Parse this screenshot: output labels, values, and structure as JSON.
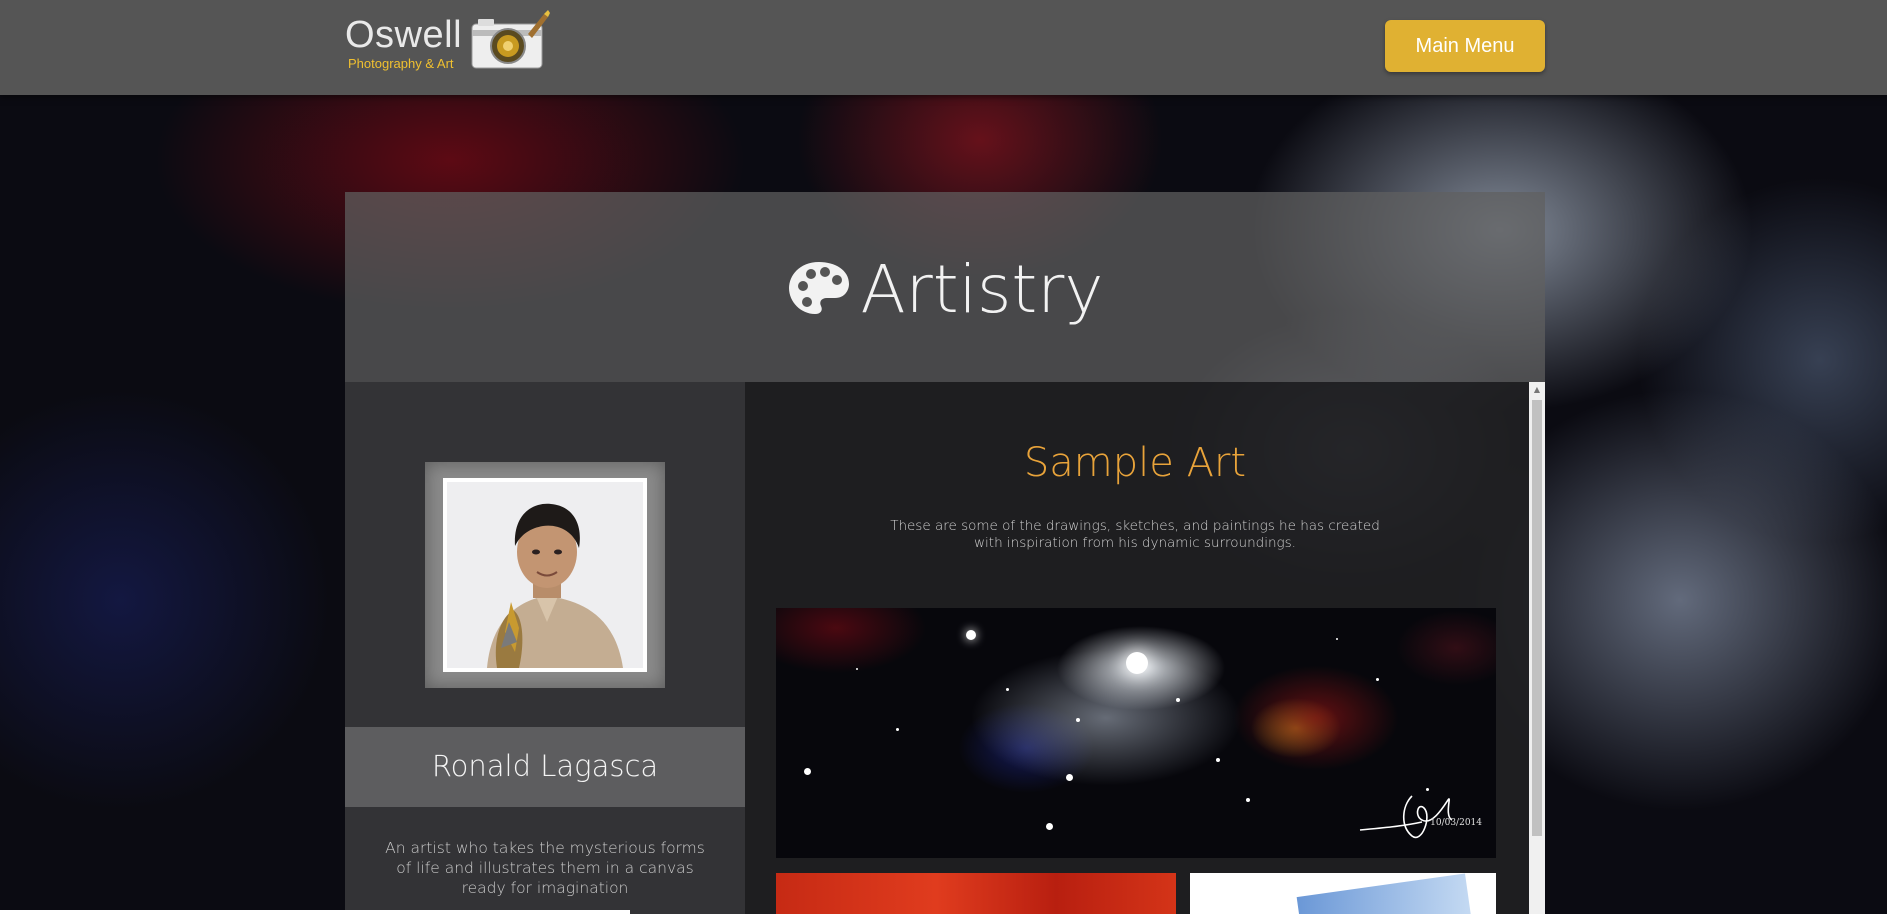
{
  "header": {
    "logo_name": "Oswell",
    "logo_tagline": "Photography & Art",
    "menu_button_label": "Main Menu",
    "accent_color": "#e0b132"
  },
  "page": {
    "title": "Artistry",
    "title_icon": "palette-icon"
  },
  "profile": {
    "name": "Ronald Lagasca",
    "bio": "An artist who takes the mysterious forms of life and illustrates them in a canvas ready for imagination"
  },
  "gallery": {
    "section_title": "Sample Art",
    "section_title_color": "#e8a33a",
    "description": "These are some of the drawings, sketches, and paintings he has created with inspiration from his dynamic surroundings.",
    "featured_date": "10/03/2014"
  }
}
